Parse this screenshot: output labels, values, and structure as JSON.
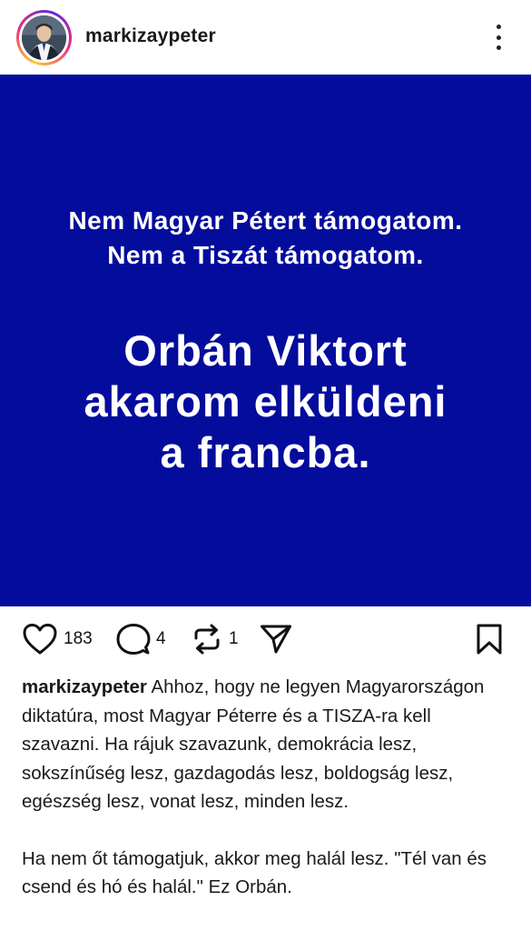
{
  "header": {
    "username": "markizaypeter",
    "avatar_icon": "profile-photo",
    "more_icon": "more-vertical-icon"
  },
  "post": {
    "background_color": "#040c9c",
    "text_color": "#ffffff",
    "line1": "Nem Magyar Pétert támogatom.",
    "line2": "Nem a Tiszát támogatom.",
    "big_line1": "Orbán Viktort",
    "big_line2": "akarom elküldeni",
    "big_line3": "a francba."
  },
  "actions": {
    "like_count": "183",
    "comment_count": "4",
    "repost_count": "1",
    "icons": [
      "heart-icon",
      "comment-icon",
      "repost-icon",
      "share-icon",
      "bookmark-icon"
    ]
  },
  "caption": {
    "username": "markizaypeter",
    "paragraph1": "Ahhoz, hogy ne legyen Magyarországon diktatúra, most Magyar Péterre és a TISZA-ra kell szavazni. Ha rájuk szavazunk, demokrácia lesz, sokszínűség lesz, gazdagodás lesz, boldogság lesz, egészség lesz, vonat lesz, minden lesz.",
    "paragraph2": "Ha nem őt támogatjuk, akkor meg halál lesz. \"Tél van és csend és hó és halál.\" Ez Orbán."
  }
}
